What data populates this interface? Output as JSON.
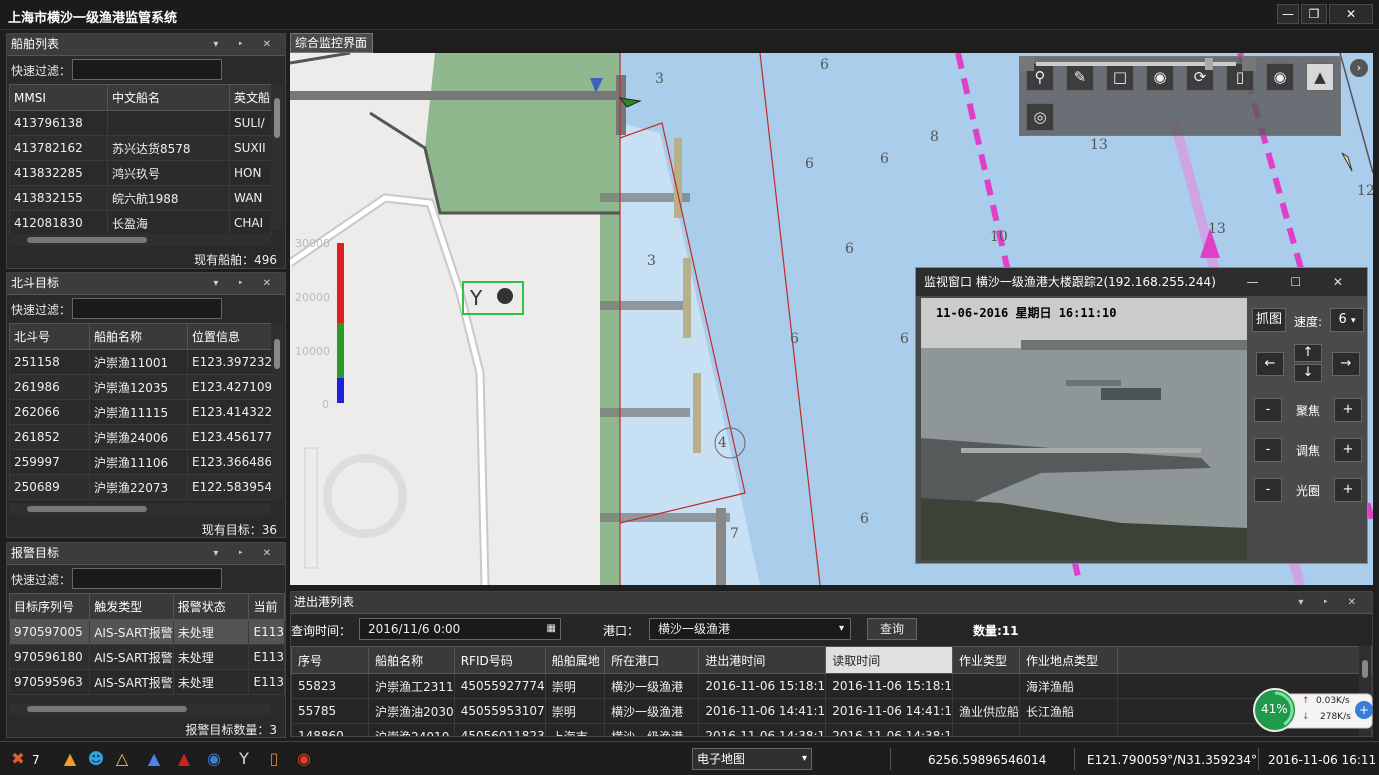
{
  "app": {
    "title": "上海市横沙一级渔港监管系统",
    "window_controls": [
      "—",
      "❐",
      "✕"
    ]
  },
  "panel_ships": {
    "title": "船舶列表",
    "filter_label": "快速过滤：",
    "columns": [
      "MMSI",
      "中文船名",
      "英文船"
    ],
    "rows": [
      [
        "413796138",
        "",
        "SULI/"
      ],
      [
        "413782162",
        "苏兴达货8578",
        "SUXII"
      ],
      [
        "413832285",
        "鸿兴玖号",
        "HON"
      ],
      [
        "413832155",
        "皖六航1988",
        "WAN"
      ],
      [
        "412081830",
        "长盈海",
        "CHAI"
      ]
    ],
    "footer": "现有船舶：496"
  },
  "panel_beidou": {
    "title": "北斗目标",
    "filter_label": "快速过滤：",
    "columns": [
      "北斗号",
      "船舶名称",
      "位置信息"
    ],
    "rows": [
      [
        "251158",
        "沪崇渔11001",
        "E123.397232"
      ],
      [
        "261986",
        "沪崇渔12035",
        "E123.427109"
      ],
      [
        "262066",
        "沪崇渔11115",
        "E123.414322"
      ],
      [
        "261852",
        "沪崇渔24006",
        "E123.456177"
      ],
      [
        "259997",
        "沪崇渔11106",
        "E123.366486"
      ],
      [
        "250689",
        "沪崇渔22073",
        "E122.583954"
      ]
    ],
    "footer": "现有目标：36"
  },
  "panel_alarm": {
    "title": "报警目标",
    "filter_label": "快速过滤：",
    "columns": [
      "目标序列号",
      "触发类型",
      "报警状态",
      "当前"
    ],
    "rows": [
      [
        "970597005",
        "AIS-SART报警",
        "未处理",
        "E113"
      ],
      [
        "970596180",
        "AIS-SART报警",
        "未处理",
        "E113"
      ],
      [
        "970595963",
        "AIS-SART报警",
        "未处理",
        "E113"
      ]
    ],
    "footer": "报警目标数量：3"
  },
  "map": {
    "tab_label": "综合监控界面",
    "depth_labels": [
      "3",
      "6",
      "8",
      "13",
      "12",
      "6",
      "6",
      "13",
      "10",
      "6",
      "3",
      "6",
      "6",
      "4",
      "6",
      "7"
    ],
    "scale_labels": [
      "30000",
      "20000",
      "10000",
      "0"
    ],
    "toolbar_icons": [
      "magnifier-icon",
      "pencil-icon",
      "monitor-icon",
      "location-pin-icon",
      "refresh-icon",
      "device-icon",
      "globe-icon",
      "ship-icon",
      "compass-icon"
    ],
    "zoom_level": 0.88
  },
  "video": {
    "title": "监视窗口 横沙一级渔港大楼跟踪2(192.168.255.244)",
    "timestamp": "11-06-2016  星期日  16:11:10",
    "capture_label": "抓图",
    "speed_label": "速度:",
    "speed_value": "6",
    "focus_label": "聚焦",
    "zoom_label": "调焦",
    "iris_label": "光圈",
    "minus": "-",
    "plus": "+",
    "arrow_left": "←",
    "arrow_right": "→",
    "arrow_up": "↑",
    "arrow_down": "↓"
  },
  "port_list": {
    "title": "进出港列表",
    "query_time_label": "查询时间：",
    "query_time_value": "2016/11/6 0:00",
    "port_label": "港口：",
    "port_value": "横沙一级渔港",
    "query_button": "查询",
    "count_label": "数量:11",
    "columns": [
      "序号",
      "船舶名称",
      "RFID号码",
      "船舶属地",
      "所在港口",
      "进出港时间",
      "读取时间",
      "作业类型",
      "作业地点类型"
    ],
    "rows": [
      [
        "55823",
        "沪崇渔工2311",
        "45055927774",
        "崇明",
        "横沙一级渔港",
        "2016-11-06 15:18:1",
        "2016-11-06 15:18:1",
        "",
        "海洋渔船"
      ],
      [
        "55785",
        "沪崇渔油2030",
        "45055953107",
        "崇明",
        "横沙一级渔港",
        "2016-11-06 14:41:1",
        "2016-11-06 14:41:1",
        "渔业供应船",
        "长江渔船"
      ],
      [
        "148860",
        "沪崇渔24010",
        "45056011823",
        "上海市",
        "横沙一级渔港",
        "2016-11-06 14:38:1",
        "2016-11-06 14:38:1",
        "",
        ""
      ]
    ]
  },
  "statusbar": {
    "alarm_count": "7",
    "map_type": "电子地图",
    "scale_value": "6256.59896546014",
    "coordinates": "E121.790059°/N31.359234°",
    "datetime": "2016-11-06 16:11"
  },
  "network": {
    "cpu_percent": "41%",
    "cpu_fraction": 0.41,
    "upload": "0.03K/s",
    "download": "278K/s"
  },
  "colors": {
    "land_green": "#8fb88f",
    "water_blue": "#a9cdea",
    "channel_magenta": "#e040c8",
    "alarm_red": "#e03020"
  }
}
